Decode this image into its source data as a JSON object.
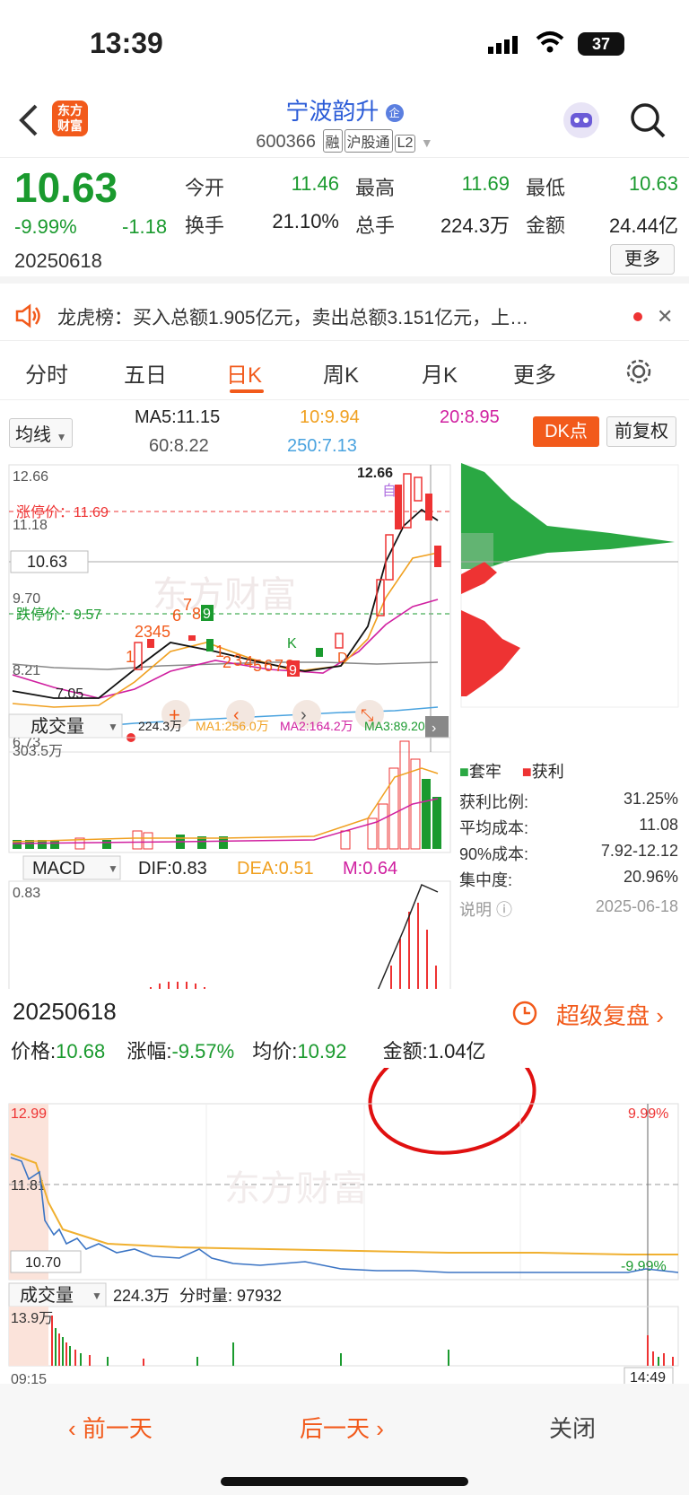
{
  "status": {
    "time": "13:39",
    "battery": "37"
  },
  "header": {
    "logo_line1": "东方",
    "logo_line2": "财富",
    "name": "宁波韵升",
    "code": "600366",
    "tags": [
      "融",
      "沪股通",
      "L2"
    ]
  },
  "quote": {
    "price": "10.63",
    "pct": "-9.99%",
    "change": "-1.18",
    "date": "20250618",
    "fields": [
      {
        "label": "今开",
        "value": "11.46",
        "color": "green"
      },
      {
        "label": "最高",
        "value": "11.69",
        "color": "green"
      },
      {
        "label": "最低",
        "value": "10.63",
        "color": "green"
      },
      {
        "label": "换手",
        "value": "21.10%",
        "color": "dark"
      },
      {
        "label": "总手",
        "value": "224.3万",
        "color": "dark"
      },
      {
        "label": "金额",
        "value": "24.44亿",
        "color": "dark"
      }
    ],
    "more_label": "更多"
  },
  "notice": {
    "text": "龙虎榜：买入总额1.905亿元，卖出总额3.151亿元，上…"
  },
  "tabs": [
    "分时",
    "五日",
    "日K",
    "周K",
    "月K",
    "更多"
  ],
  "active_tab": "日K",
  "kline": {
    "ma_select": "均线",
    "ma5": "MA5:11.15",
    "ma10": "10:9.94",
    "ma20": "20:8.95",
    "ma60": "60:8.22",
    "ma250": "250:7.13",
    "dk_label": "DK点",
    "fq_label": "前复权",
    "y_high": "12.66",
    "y_1118": "11.18",
    "y_970": "9.70",
    "y_821": "8.21",
    "y_low": "6.73",
    "limit_up": "涨停价：11.69",
    "limit_down": "跌停价：9.57",
    "cur_price_box": "10.63",
    "high_marker": "12.66",
    "low_marker": "7.05",
    "watermark": "东方财富",
    "seq_labels": [
      "1",
      "2345",
      "6",
      "7",
      "8",
      "9",
      "1",
      "2",
      "3",
      "4",
      "5",
      "6",
      "7",
      "8",
      "9",
      "K",
      "D",
      "自"
    ]
  },
  "chips": {
    "legend_lock": "套牢",
    "legend_profit": "获利",
    "rows": [
      {
        "label": "获利比例:",
        "value": "31.25%"
      },
      {
        "label": "平均成本:",
        "value": "11.08"
      },
      {
        "label": "90%成本:",
        "value": "7.92-12.12"
      },
      {
        "label": "集中度:",
        "value": "20.96%"
      }
    ],
    "note": "说明",
    "date": "2025-06-18"
  },
  "volume": {
    "select": "成交量",
    "vol": "224.3万",
    "ma1": "MA1:256.0万",
    "ma2": "MA2:164.2万",
    "ma3": "MA3:89.20万",
    "max": "303.5万"
  },
  "macd": {
    "select": "MACD",
    "dif": "DIF:0.83",
    "dea": "DEA:0.51",
    "m": "M:0.64",
    "max": "0.83"
  },
  "intraday": {
    "date": "20250618",
    "super_replay": "超级复盘",
    "price_label": "价格:",
    "price": "10.68",
    "chg_label": "涨幅:",
    "chg": "-9.57%",
    "avg_label": "均价:",
    "avg": "10.92",
    "amt_label": "金额:",
    "amt": "1.04亿",
    "y_top": "12.99",
    "y_mid": "11.81",
    "y_low": "10.70",
    "pct_top": "9.99%",
    "pct_low": "-9.99%",
    "vol_select": "成交量",
    "vol_total": "224.3万",
    "vol_min": "分时量: 97932",
    "vol_max": "13.9万",
    "t_start": "09:15",
    "t_cursor": "14:49"
  },
  "bottom": {
    "prev": "前一天",
    "next": "后一天",
    "close": "关闭"
  },
  "colors": {
    "accent": "#f25a1b",
    "up": "#e33333",
    "down": "#1a9a2e"
  }
}
